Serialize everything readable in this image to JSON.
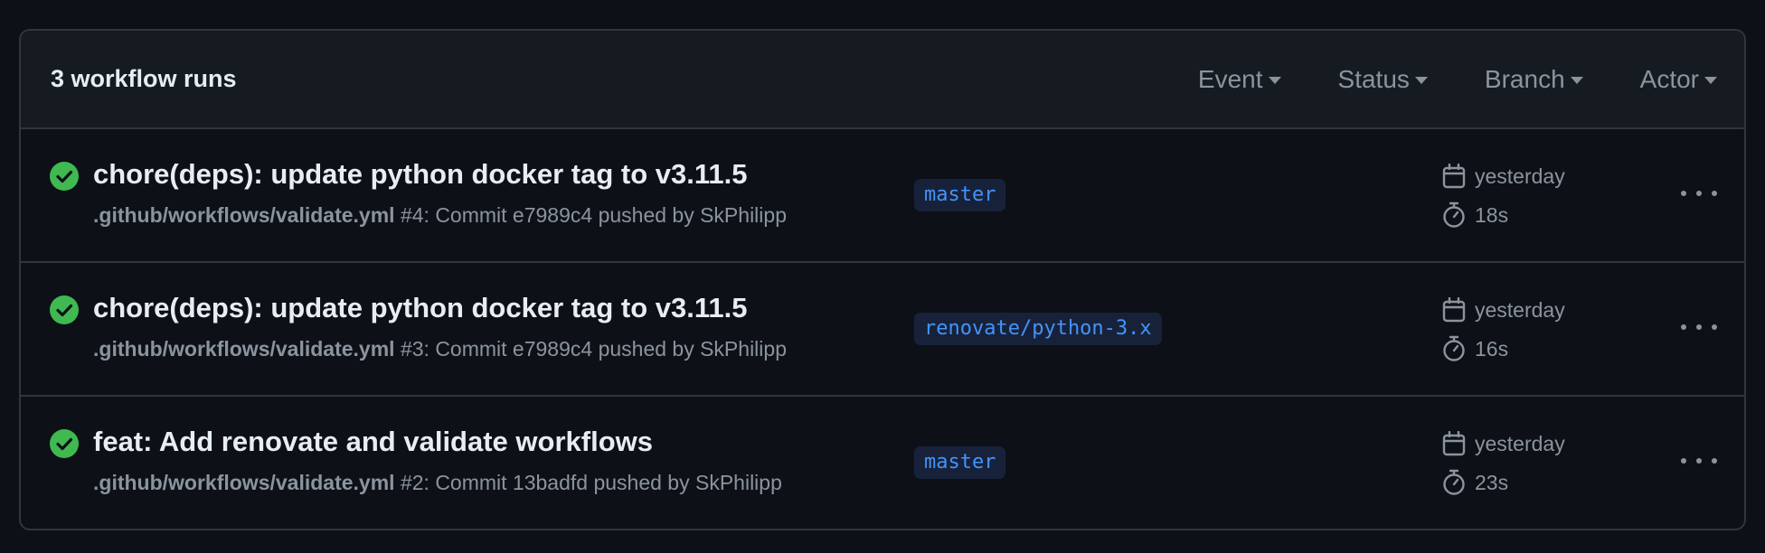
{
  "header": {
    "runs_count": "3 workflow runs",
    "filters": [
      "Event",
      "Status",
      "Branch",
      "Actor"
    ]
  },
  "runs": [
    {
      "status": "success",
      "title": "chore(deps): update python docker tag to v3.11.5",
      "workflow": ".github/workflows/validate.yml",
      "details": " #4: Commit e7989c4 pushed by SkPhilipp",
      "branch": "master",
      "when": "yesterday",
      "duration": "18s"
    },
    {
      "status": "success",
      "title": "chore(deps): update python docker tag to v3.11.5",
      "workflow": ".github/workflows/validate.yml",
      "details": " #3: Commit e7989c4 pushed by SkPhilipp",
      "branch": "renovate/python-3.x",
      "when": "yesterday",
      "duration": "16s"
    },
    {
      "status": "success",
      "title": "feat: Add renovate and validate workflows",
      "workflow": ".github/workflows/validate.yml",
      "details": " #2: Commit 13badfd pushed by SkPhilipp",
      "branch": "master",
      "when": "yesterday",
      "duration": "23s"
    }
  ],
  "colors": {
    "background": "#0d1117",
    "header_bg": "#161b22",
    "border": "#30363d",
    "success": "#3fb950",
    "branch_text": "#4493f8",
    "muted": "#8b949e"
  },
  "icons": {
    "status": "check-circle-fill-icon",
    "when": "calendar-icon",
    "duration": "stopwatch-icon",
    "more": "kebab-horizontal-icon",
    "filter_caret": "triangle-down-icon"
  }
}
